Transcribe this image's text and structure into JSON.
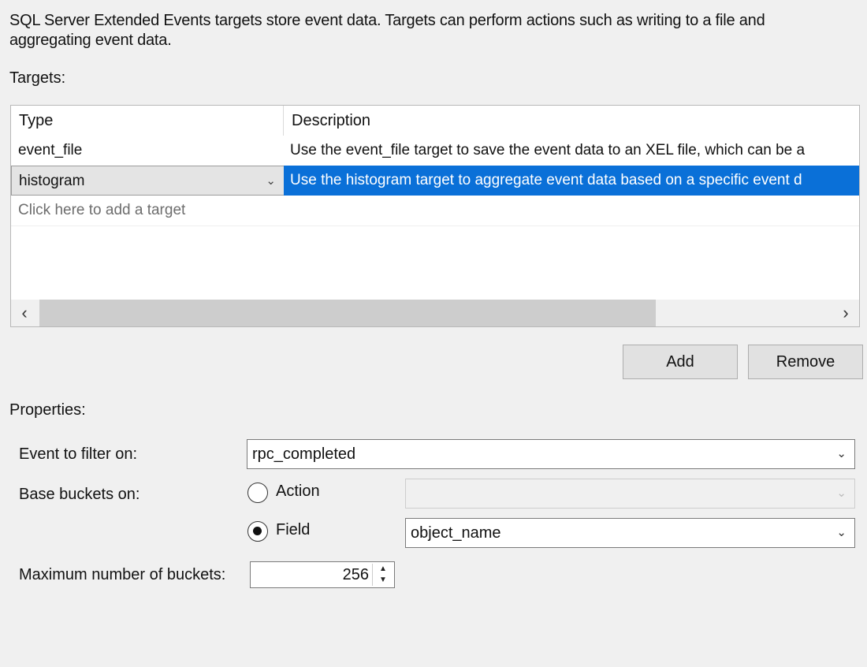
{
  "intro": {
    "line1": "SQL Server Extended Events targets store event data. Targets can perform actions such as writing to a file and",
    "line2": "aggregating event data."
  },
  "targets_label": "Targets:",
  "targets_grid": {
    "columns": [
      "Type",
      "Description"
    ],
    "rows": [
      {
        "type": "event_file",
        "description": "Use the event_file target to save the event data to an XEL file, which can be a"
      },
      {
        "type": "histogram",
        "description": "Use the histogram target to aggregate event data based on a specific event d",
        "selected": true
      }
    ],
    "add_placeholder": "Click here to add a target"
  },
  "buttons": {
    "add": "Add",
    "remove": "Remove"
  },
  "properties_label": "Properties:",
  "properties": {
    "event_filter_label": "Event to filter on:",
    "event_filter_value": "rpc_completed",
    "base_buckets_label": "Base buckets on:",
    "action_label": "Action",
    "action_value": "",
    "field_label": "Field",
    "field_value": "object_name",
    "base_buckets_selected": "Field",
    "max_buckets_label": "Maximum number of buckets:",
    "max_buckets_value": "256"
  },
  "icons": {
    "dropdown": "chevron-down-icon",
    "scroll_left": "chevron-left-icon",
    "scroll_right": "chevron-right-icon",
    "spin": "spinner-arrows-icon"
  },
  "colors": {
    "selection": "#0a70d8",
    "background": "#f0f0f0"
  }
}
